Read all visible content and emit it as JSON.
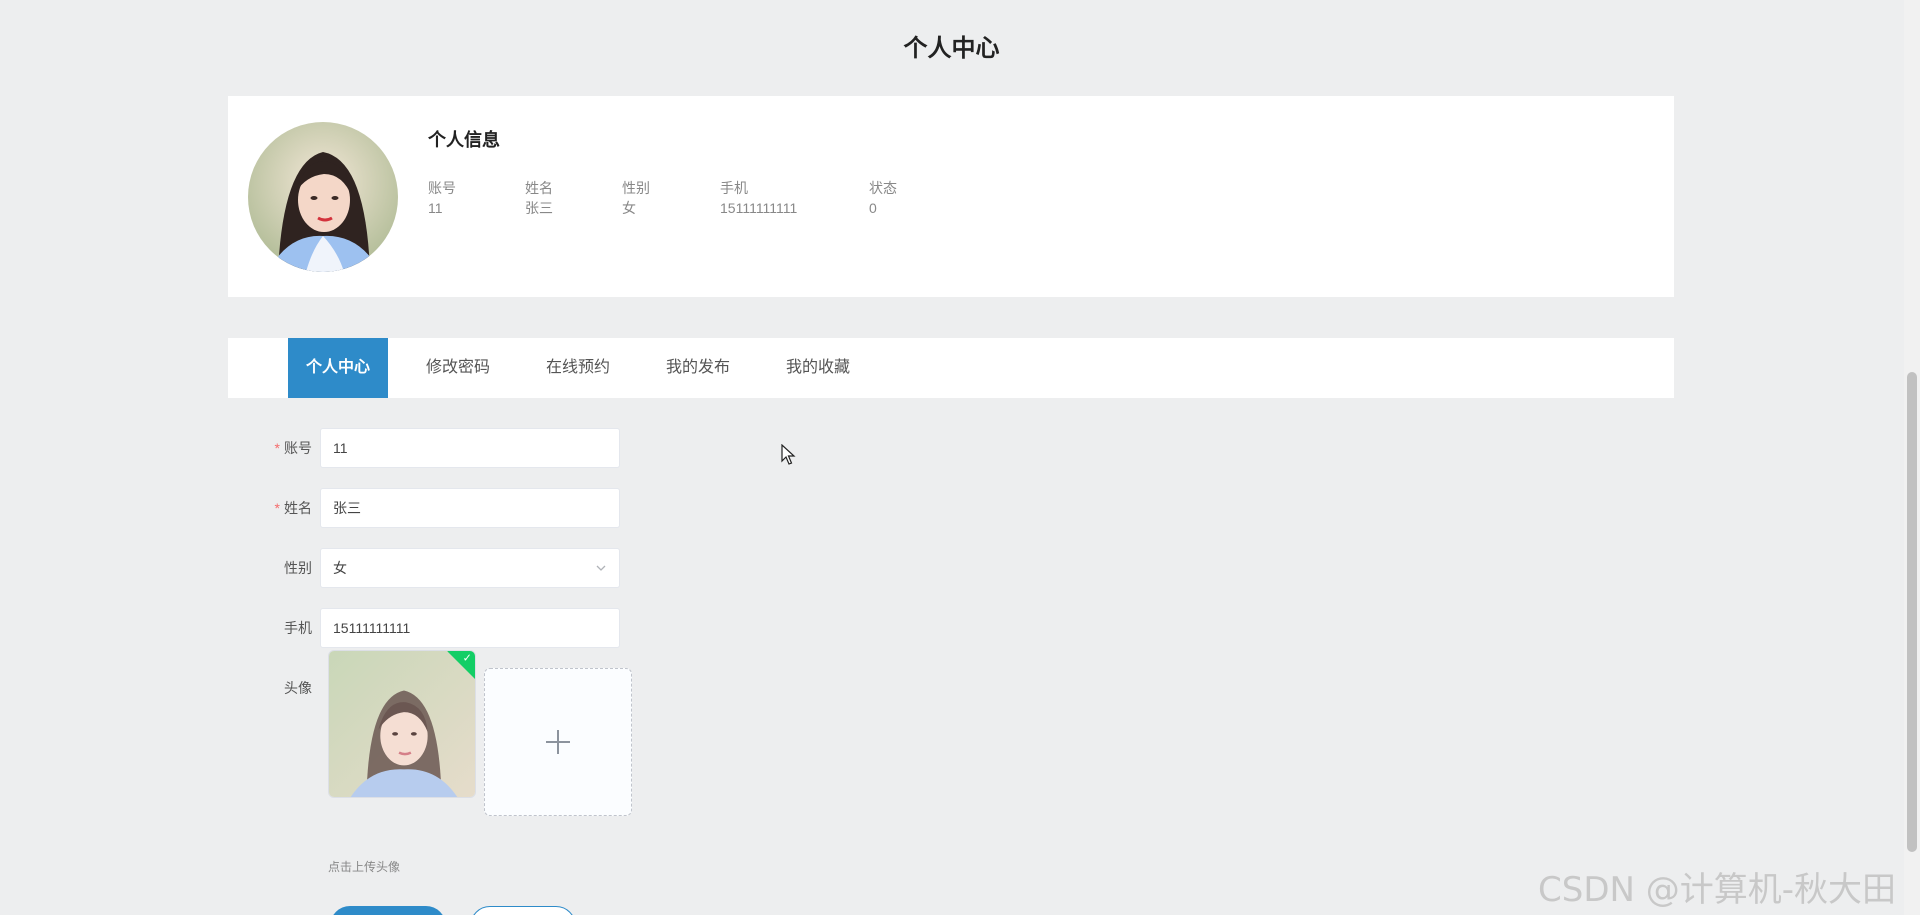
{
  "page": {
    "title": "个人中心"
  },
  "info": {
    "title": "个人信息",
    "fields": [
      {
        "label": "账号",
        "value": "11"
      },
      {
        "label": "姓名",
        "value": "张三"
      },
      {
        "label": "性别",
        "value": "女"
      },
      {
        "label": "手机",
        "value": "15111111111"
      },
      {
        "label": "状态",
        "value": "0"
      }
    ]
  },
  "tabs": [
    {
      "label": "个人中心",
      "active": true
    },
    {
      "label": "修改密码",
      "active": false
    },
    {
      "label": "在线预约",
      "active": false
    },
    {
      "label": "我的发布",
      "active": false
    },
    {
      "label": "我的收藏",
      "active": false
    }
  ],
  "form": {
    "account": {
      "label": "账号",
      "value": "11",
      "required": true
    },
    "name": {
      "label": "姓名",
      "value": "张三",
      "required": true
    },
    "gender": {
      "label": "性别",
      "value": "女"
    },
    "phone": {
      "label": "手机",
      "value": "15111111111"
    },
    "avatar": {
      "label": "头像",
      "hint": "点击上传头像"
    }
  },
  "watermark": "CSDN @计算机-秋大田",
  "colors": {
    "primary": "#2e8bc9",
    "required": "#f56c6c",
    "background": "#edeeef"
  },
  "icons": {
    "select": "chevron-down-icon",
    "upload": "plus-icon",
    "uploaded": "check-icon"
  }
}
